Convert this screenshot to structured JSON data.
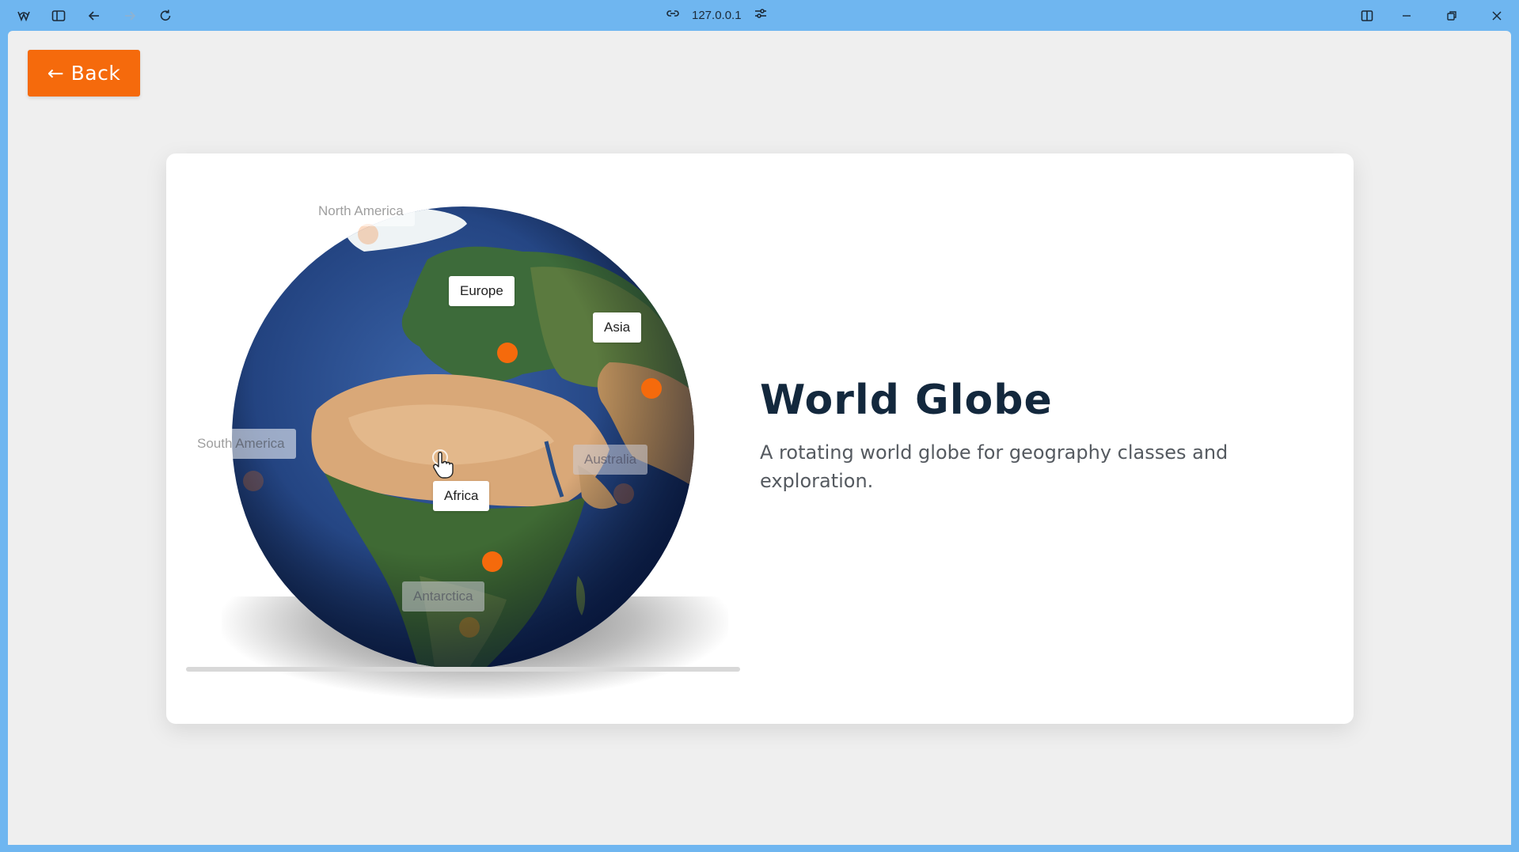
{
  "browser": {
    "address": "127.0.0.1",
    "icons": {
      "app": "app-logo-icon",
      "sidebar": "sidebar-toggle-icon",
      "back": "arrow-left-icon",
      "forward": "arrow-right-icon",
      "reload": "reload-icon",
      "link": "link-icon",
      "site_settings": "sliders-icon",
      "split": "split-view-icon",
      "minimize": "minimize-icon",
      "restore": "restore-icon",
      "close": "close-icon"
    }
  },
  "page": {
    "back_label": "← Back",
    "title": "World Globe",
    "description": "A rotating world globe for geography classes and exploration.",
    "accent": "#f56a0c",
    "background": "#efefef"
  },
  "globe": {
    "labels": {
      "north_america": "North America",
      "europe": "Europe",
      "asia": "Asia",
      "south_america": "South America",
      "australia": "Australia",
      "africa": "Africa",
      "antarctica": "Antarctica"
    },
    "marker_color": "#f56a0c"
  }
}
